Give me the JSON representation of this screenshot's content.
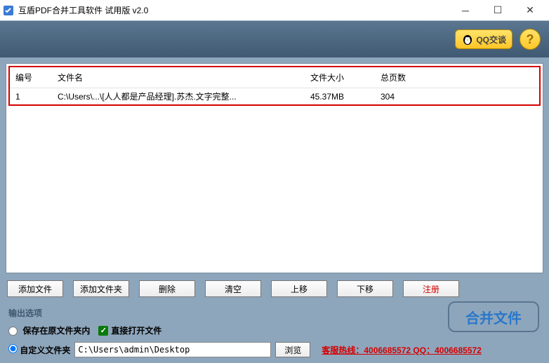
{
  "window": {
    "title": "互盾PDF合并工具软件 试用版 v2.0"
  },
  "topbar": {
    "qq_label": "QQ交谈",
    "help_label": "?"
  },
  "table": {
    "headers": {
      "id": "编号",
      "name": "文件名",
      "size": "文件大小",
      "pages": "总页数"
    },
    "rows": [
      {
        "id": "1",
        "name": "C:\\Users\\...\\[人人都是产品经理].苏杰.文字完整...",
        "size": "45.37MB",
        "pages": "304"
      }
    ]
  },
  "buttons": {
    "add_file": "添加文件",
    "add_folder": "添加文件夹",
    "delete": "删除",
    "clear": "清空",
    "move_up": "上移",
    "move_down": "下移",
    "register": "注册"
  },
  "output": {
    "section_label": "输出选项",
    "save_original": "保存在原文件夹内",
    "open_direct": "直接打开文件",
    "custom_folder": "自定义文件夹",
    "path": "C:\\Users\\admin\\Desktop",
    "browse": "浏览",
    "merge": "合并文件"
  },
  "hotline": "客服热线：4006685572 QQ：4006685572"
}
